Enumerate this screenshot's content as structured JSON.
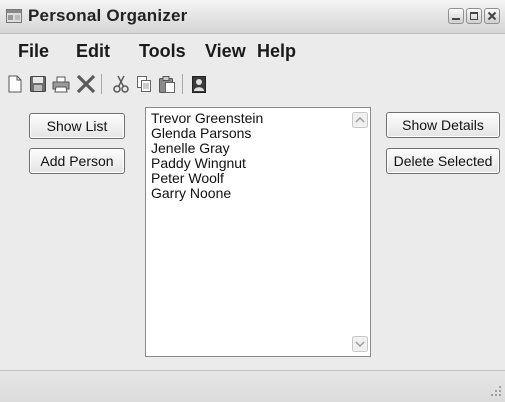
{
  "window": {
    "title": "Personal Organizer"
  },
  "menu": [
    "File",
    "Edit",
    "Tools",
    "View",
    "Help"
  ],
  "toolbar": {
    "icons": [
      "new-document-icon",
      "save-icon",
      "print-icon",
      "delete-icon",
      "cut-icon",
      "copy-icon",
      "paste-icon",
      "contacts-icon"
    ]
  },
  "buttons": {
    "show_list": "Show List",
    "add_person": "Add Person",
    "show_details": "Show Details",
    "delete_selected": "Delete Selected"
  },
  "people": [
    "Trevor Greenstein",
    "Glenda Parsons",
    "Jenelle Gray",
    "Paddy Wingnut",
    "Peter Woolf",
    "Garry Noone"
  ]
}
